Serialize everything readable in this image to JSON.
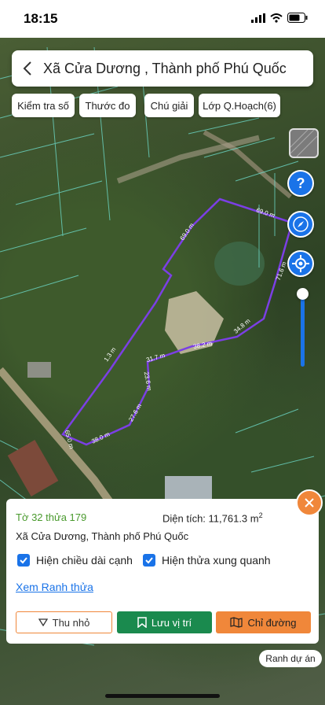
{
  "status_bar": {
    "time": "18:15"
  },
  "header": {
    "title": "Xã Cửa Dương , Thành phố Phú Quốc"
  },
  "toolbar": {
    "chips": [
      "Kiểm tra số",
      "Thước đo",
      "Chú giải",
      "Lớp Q.Hoạch(6)"
    ]
  },
  "map": {
    "edge_labels": [
      "69.0 m",
      "69.0 m",
      "71.6 m",
      "34.8 m",
      "38.2 m",
      "31.7 m",
      "23.6 m",
      "27.6 m",
      "38.0 m",
      "65.0 m",
      "1.3 m"
    ],
    "boundary_color": "#7b3fe4",
    "controls": [
      "layers-icon",
      "help-icon",
      "compass-icon",
      "locate-icon"
    ]
  },
  "panel": {
    "parcel": "Tờ 32 thửa 179",
    "area_label": "Diện tích: 11,761.3 m",
    "area_sup": "2",
    "address": "Xã Cửa Dương, Thành phố Phú Quốc",
    "check_edges": "Hiện chiều dài cạnh",
    "check_neighbors": "Hiện thửa xung quanh",
    "link": "Xem Ranh thửa",
    "btn_collapse": "Thu nhỏ",
    "btn_save": "Lưu vị trí",
    "btn_directions": "Chỉ đường"
  },
  "project_button": "Ranh dự án",
  "colors": {
    "accent": "#f0873a",
    "green": "#1a8a4e",
    "blue": "#1a73e8",
    "parcel_text": "#4a9a2e"
  }
}
